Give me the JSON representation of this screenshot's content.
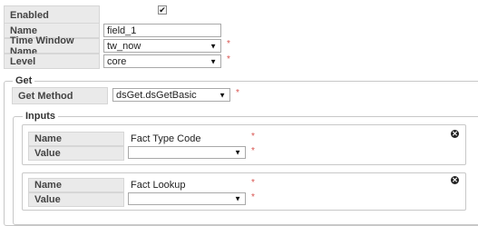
{
  "form": {
    "enabled": {
      "label": "Enabled",
      "checked": true,
      "check_glyph": "✔"
    },
    "name": {
      "label": "Name",
      "value": "field_1"
    },
    "time_window": {
      "label": "Time Window Name",
      "value": "tw_now",
      "required": "*"
    },
    "level": {
      "label": "Level",
      "value": "core",
      "required": "*"
    }
  },
  "get_section": {
    "legend": "Get",
    "method": {
      "label": "Get Method",
      "value": "dsGet.dsGetBasic",
      "required": "*"
    },
    "inputs": {
      "legend": "Inputs",
      "items": [
        {
          "name_label": "Name",
          "name_value": "Fact Type Code",
          "name_required": "*",
          "value_label": "Value",
          "value_value": "",
          "value_required": "*",
          "close_icon": "x-circle-icon"
        },
        {
          "name_label": "Name",
          "name_value": "Fact Lookup",
          "name_required": "*",
          "value_label": "Value",
          "value_value": "",
          "value_required": "*",
          "close_icon": "x-circle-icon"
        }
      ]
    }
  },
  "icons": {
    "dropdown_arrow": "▼",
    "close_glyph": "✕"
  },
  "colors": {
    "required": "#d9534f",
    "label_bg": "#eaeaea"
  }
}
